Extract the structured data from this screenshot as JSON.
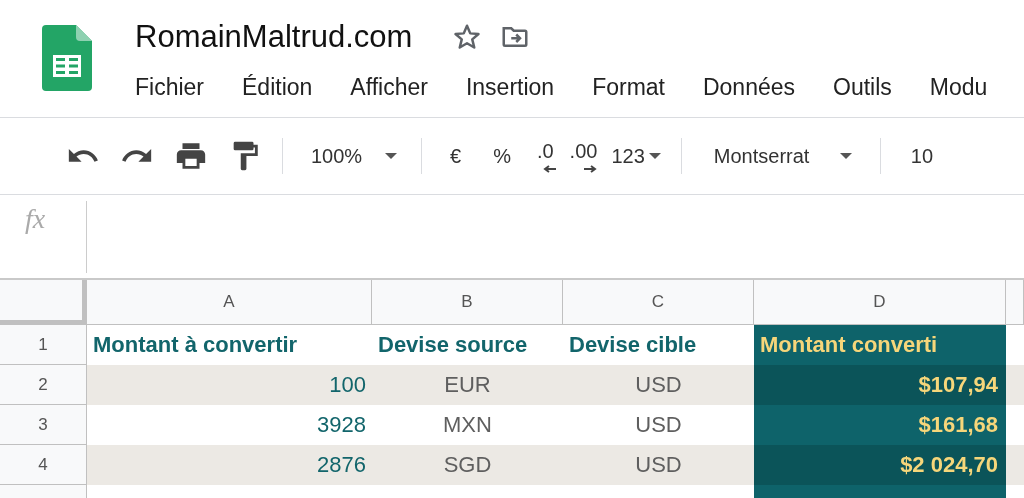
{
  "document": {
    "title": "RomainMaltrud.com"
  },
  "menu": [
    "Fichier",
    "Édition",
    "Afficher",
    "Insertion",
    "Format",
    "Données",
    "Outils",
    "Modu"
  ],
  "toolbar": {
    "zoom": "100%",
    "currency": "€",
    "percent": "%",
    "decrease_decimals": ".0",
    "increase_decimals": ".00",
    "number_format": "123",
    "font": "Montserrat",
    "font_size": "10"
  },
  "formula_bar": {
    "label": "fx"
  },
  "sheet": {
    "columns": [
      "A",
      "B",
      "C",
      "D"
    ],
    "rows": [
      {
        "number": "1",
        "kind": "header",
        "cells": [
          "Montant à convertir",
          "Devise source",
          "Devise cible",
          "Montant converti"
        ]
      },
      {
        "number": "2",
        "kind": "data",
        "cells": [
          "100",
          "EUR",
          "USD",
          "$107,94"
        ]
      },
      {
        "number": "3",
        "kind": "data",
        "cells": [
          "3928",
          "MXN",
          "USD",
          "$161,68"
        ]
      },
      {
        "number": "4",
        "kind": "data",
        "cells": [
          "2876",
          "SGD",
          "USD",
          "$2 024,70"
        ]
      }
    ]
  }
}
